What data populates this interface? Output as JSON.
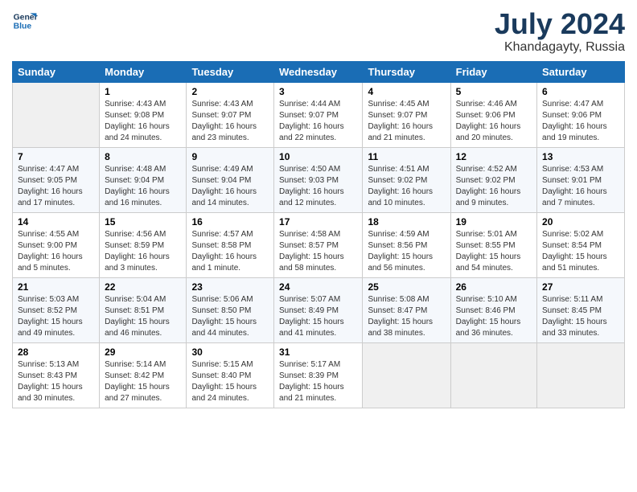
{
  "header": {
    "logo_line1": "General",
    "logo_line2": "Blue",
    "month_year": "July 2024",
    "location": "Khandagayty, Russia"
  },
  "weekdays": [
    "Sunday",
    "Monday",
    "Tuesday",
    "Wednesday",
    "Thursday",
    "Friday",
    "Saturday"
  ],
  "weeks": [
    [
      {
        "day": "",
        "sunrise": "",
        "sunset": "",
        "daylight": ""
      },
      {
        "day": "1",
        "sunrise": "Sunrise: 4:43 AM",
        "sunset": "Sunset: 9:08 PM",
        "daylight": "Daylight: 16 hours and 24 minutes."
      },
      {
        "day": "2",
        "sunrise": "Sunrise: 4:43 AM",
        "sunset": "Sunset: 9:07 PM",
        "daylight": "Daylight: 16 hours and 23 minutes."
      },
      {
        "day": "3",
        "sunrise": "Sunrise: 4:44 AM",
        "sunset": "Sunset: 9:07 PM",
        "daylight": "Daylight: 16 hours and 22 minutes."
      },
      {
        "day": "4",
        "sunrise": "Sunrise: 4:45 AM",
        "sunset": "Sunset: 9:07 PM",
        "daylight": "Daylight: 16 hours and 21 minutes."
      },
      {
        "day": "5",
        "sunrise": "Sunrise: 4:46 AM",
        "sunset": "Sunset: 9:06 PM",
        "daylight": "Daylight: 16 hours and 20 minutes."
      },
      {
        "day": "6",
        "sunrise": "Sunrise: 4:47 AM",
        "sunset": "Sunset: 9:06 PM",
        "daylight": "Daylight: 16 hours and 19 minutes."
      }
    ],
    [
      {
        "day": "7",
        "sunrise": "Sunrise: 4:47 AM",
        "sunset": "Sunset: 9:05 PM",
        "daylight": "Daylight: 16 hours and 17 minutes."
      },
      {
        "day": "8",
        "sunrise": "Sunrise: 4:48 AM",
        "sunset": "Sunset: 9:04 PM",
        "daylight": "Daylight: 16 hours and 16 minutes."
      },
      {
        "day": "9",
        "sunrise": "Sunrise: 4:49 AM",
        "sunset": "Sunset: 9:04 PM",
        "daylight": "Daylight: 16 hours and 14 minutes."
      },
      {
        "day": "10",
        "sunrise": "Sunrise: 4:50 AM",
        "sunset": "Sunset: 9:03 PM",
        "daylight": "Daylight: 16 hours and 12 minutes."
      },
      {
        "day": "11",
        "sunrise": "Sunrise: 4:51 AM",
        "sunset": "Sunset: 9:02 PM",
        "daylight": "Daylight: 16 hours and 10 minutes."
      },
      {
        "day": "12",
        "sunrise": "Sunrise: 4:52 AM",
        "sunset": "Sunset: 9:02 PM",
        "daylight": "Daylight: 16 hours and 9 minutes."
      },
      {
        "day": "13",
        "sunrise": "Sunrise: 4:53 AM",
        "sunset": "Sunset: 9:01 PM",
        "daylight": "Daylight: 16 hours and 7 minutes."
      }
    ],
    [
      {
        "day": "14",
        "sunrise": "Sunrise: 4:55 AM",
        "sunset": "Sunset: 9:00 PM",
        "daylight": "Daylight: 16 hours and 5 minutes."
      },
      {
        "day": "15",
        "sunrise": "Sunrise: 4:56 AM",
        "sunset": "Sunset: 8:59 PM",
        "daylight": "Daylight: 16 hours and 3 minutes."
      },
      {
        "day": "16",
        "sunrise": "Sunrise: 4:57 AM",
        "sunset": "Sunset: 8:58 PM",
        "daylight": "Daylight: 16 hours and 1 minute."
      },
      {
        "day": "17",
        "sunrise": "Sunrise: 4:58 AM",
        "sunset": "Sunset: 8:57 PM",
        "daylight": "Daylight: 15 hours and 58 minutes."
      },
      {
        "day": "18",
        "sunrise": "Sunrise: 4:59 AM",
        "sunset": "Sunset: 8:56 PM",
        "daylight": "Daylight: 15 hours and 56 minutes."
      },
      {
        "day": "19",
        "sunrise": "Sunrise: 5:01 AM",
        "sunset": "Sunset: 8:55 PM",
        "daylight": "Daylight: 15 hours and 54 minutes."
      },
      {
        "day": "20",
        "sunrise": "Sunrise: 5:02 AM",
        "sunset": "Sunset: 8:54 PM",
        "daylight": "Daylight: 15 hours and 51 minutes."
      }
    ],
    [
      {
        "day": "21",
        "sunrise": "Sunrise: 5:03 AM",
        "sunset": "Sunset: 8:52 PM",
        "daylight": "Daylight: 15 hours and 49 minutes."
      },
      {
        "day": "22",
        "sunrise": "Sunrise: 5:04 AM",
        "sunset": "Sunset: 8:51 PM",
        "daylight": "Daylight: 15 hours and 46 minutes."
      },
      {
        "day": "23",
        "sunrise": "Sunrise: 5:06 AM",
        "sunset": "Sunset: 8:50 PM",
        "daylight": "Daylight: 15 hours and 44 minutes."
      },
      {
        "day": "24",
        "sunrise": "Sunrise: 5:07 AM",
        "sunset": "Sunset: 8:49 PM",
        "daylight": "Daylight: 15 hours and 41 minutes."
      },
      {
        "day": "25",
        "sunrise": "Sunrise: 5:08 AM",
        "sunset": "Sunset: 8:47 PM",
        "daylight": "Daylight: 15 hours and 38 minutes."
      },
      {
        "day": "26",
        "sunrise": "Sunrise: 5:10 AM",
        "sunset": "Sunset: 8:46 PM",
        "daylight": "Daylight: 15 hours and 36 minutes."
      },
      {
        "day": "27",
        "sunrise": "Sunrise: 5:11 AM",
        "sunset": "Sunset: 8:45 PM",
        "daylight": "Daylight: 15 hours and 33 minutes."
      }
    ],
    [
      {
        "day": "28",
        "sunrise": "Sunrise: 5:13 AM",
        "sunset": "Sunset: 8:43 PM",
        "daylight": "Daylight: 15 hours and 30 minutes."
      },
      {
        "day": "29",
        "sunrise": "Sunrise: 5:14 AM",
        "sunset": "Sunset: 8:42 PM",
        "daylight": "Daylight: 15 hours and 27 minutes."
      },
      {
        "day": "30",
        "sunrise": "Sunrise: 5:15 AM",
        "sunset": "Sunset: 8:40 PM",
        "daylight": "Daylight: 15 hours and 24 minutes."
      },
      {
        "day": "31",
        "sunrise": "Sunrise: 5:17 AM",
        "sunset": "Sunset: 8:39 PM",
        "daylight": "Daylight: 15 hours and 21 minutes."
      },
      {
        "day": "",
        "sunrise": "",
        "sunset": "",
        "daylight": ""
      },
      {
        "day": "",
        "sunrise": "",
        "sunset": "",
        "daylight": ""
      },
      {
        "day": "",
        "sunrise": "",
        "sunset": "",
        "daylight": ""
      }
    ]
  ]
}
